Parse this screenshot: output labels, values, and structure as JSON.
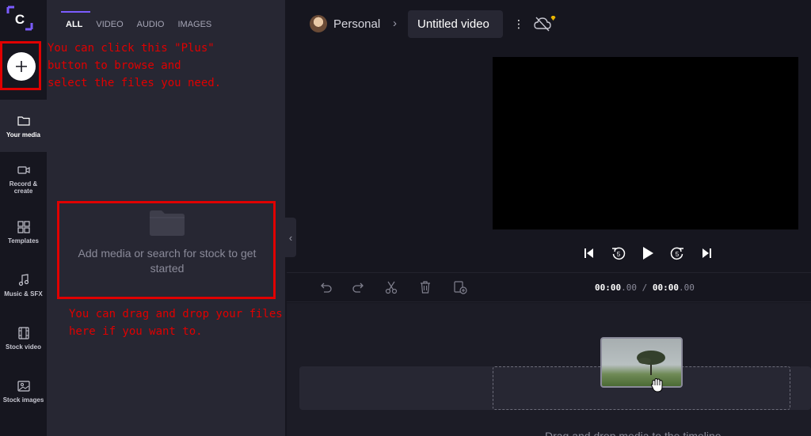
{
  "rail": {
    "logo_letter": "C",
    "items": [
      {
        "label": "Your media",
        "icon": "folder-icon"
      },
      {
        "label": "Record &\ncreate",
        "icon": "camera-icon"
      },
      {
        "label": "Templates",
        "icon": "templates-icon"
      },
      {
        "label": "Music & SFX",
        "icon": "music-icon"
      },
      {
        "label": "Stock video",
        "icon": "film-icon"
      },
      {
        "label": "Stock images",
        "icon": "image-icon"
      }
    ]
  },
  "media_panel": {
    "tabs": [
      "ALL",
      "VIDEO",
      "AUDIO",
      "IMAGES"
    ],
    "active_tab": "ALL",
    "empty_text": "Add media or search for stock to get started"
  },
  "annotations": {
    "plus_note": "You can click this \"Plus\"\nbutton to browse and\nselect the files you need.",
    "drag_note": "You can drag and drop your files\nhere if you want to."
  },
  "topbar": {
    "workspace": "Personal",
    "project_title": "Untitled video",
    "kebab": "⋮"
  },
  "timeline": {
    "current_time": "00:00",
    "current_frac": ".00",
    "separator": "/",
    "total_time": "00:00",
    "total_frac": ".00",
    "hint": "Drag and drop media to the timeline"
  },
  "colors": {
    "accent": "#7b5cff",
    "annotation": "#e00000",
    "panel_bg": "#272733",
    "app_bg": "#16161f"
  }
}
